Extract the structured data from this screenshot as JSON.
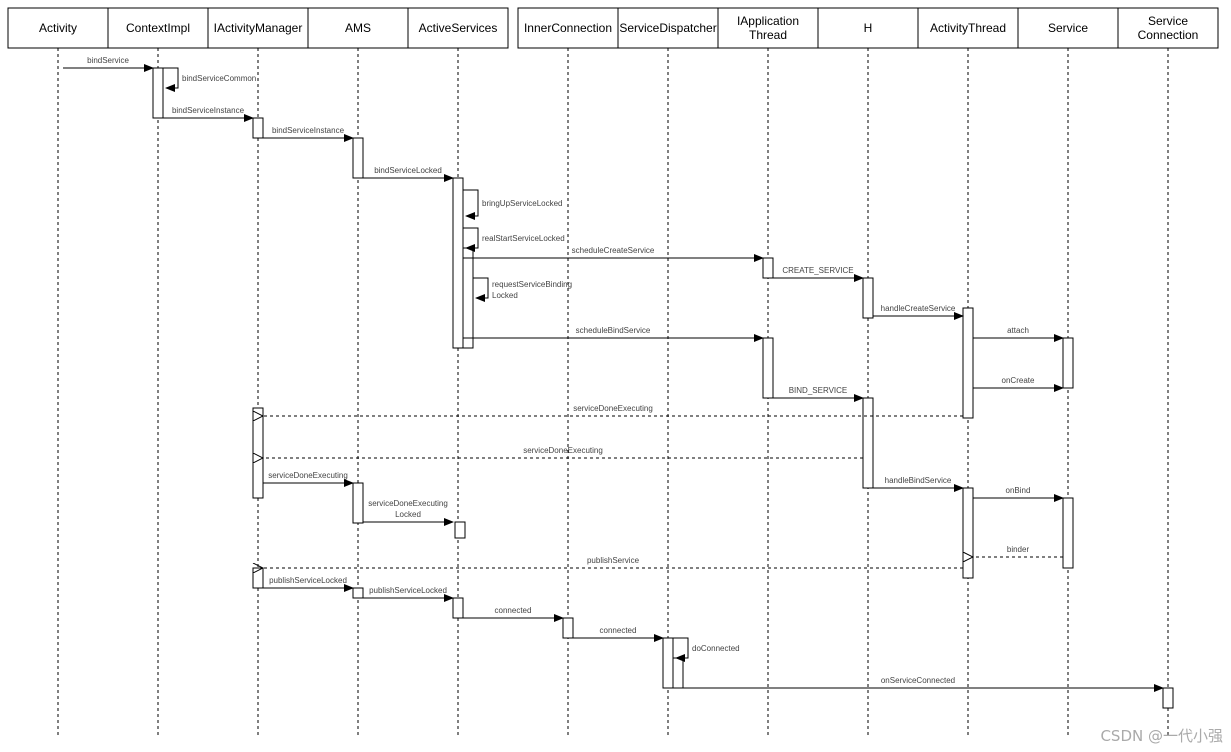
{
  "participants": [
    "Activity",
    "ContextImpl",
    "IActivityManager",
    "AMS",
    "ActiveServices",
    "InnerConnection",
    "ServiceDispatcher",
    "IApplication\nThread",
    "H",
    "ActivityThread",
    "Service",
    "Service\nConnection"
  ],
  "messages": [
    {
      "label": "bindService",
      "from": 0,
      "to": 1,
      "kind": "sync"
    },
    {
      "label": "bindServiceCommon",
      "from": 1,
      "to": 1,
      "kind": "self"
    },
    {
      "label": "bindServiceInstance",
      "from": 1,
      "to": 2,
      "kind": "sync"
    },
    {
      "label": "bindServiceInstance",
      "from": 2,
      "to": 3,
      "kind": "sync"
    },
    {
      "label": "bindServiceLocked",
      "from": 3,
      "to": 4,
      "kind": "sync"
    },
    {
      "label": "bringUpServiceLocked",
      "from": 4,
      "to": 4,
      "kind": "self"
    },
    {
      "label": "realStartServiceLocked",
      "from": 4,
      "to": 4,
      "kind": "self"
    },
    {
      "label": "scheduleCreateService",
      "from": 4,
      "to": 7,
      "kind": "sync"
    },
    {
      "label": "CREATE_SERVICE",
      "from": 7,
      "to": 8,
      "kind": "sync"
    },
    {
      "label": "requestServiceBinding\nLocked",
      "from": 4,
      "to": 4,
      "kind": "self"
    },
    {
      "label": "handleCreateService",
      "from": 8,
      "to": 9,
      "kind": "sync"
    },
    {
      "label": "scheduleBindService",
      "from": 4,
      "to": 7,
      "kind": "sync"
    },
    {
      "label": "attach",
      "from": 9,
      "to": 10,
      "kind": "sync"
    },
    {
      "label": "onCreate",
      "from": 9,
      "to": 10,
      "kind": "sync"
    },
    {
      "label": "BIND_SERVICE",
      "from": 7,
      "to": 8,
      "kind": "sync"
    },
    {
      "label": "serviceDoneExecuting",
      "from": 9,
      "to": 2,
      "kind": "return"
    },
    {
      "label": "serviceDoneExecuting",
      "from": 8,
      "to": 2,
      "kind": "return"
    },
    {
      "label": "serviceDoneExecuting",
      "from": 2,
      "to": 3,
      "kind": "sync"
    },
    {
      "label": "handleBindService",
      "from": 8,
      "to": 9,
      "kind": "sync"
    },
    {
      "label": "onBind",
      "from": 9,
      "to": 10,
      "kind": "sync"
    },
    {
      "label": "serviceDoneExecuting\nLocked",
      "from": 3,
      "to": 4,
      "kind": "sync"
    },
    {
      "label": "binder",
      "from": 10,
      "to": 9,
      "kind": "return"
    },
    {
      "label": "publishService",
      "from": 9,
      "to": 2,
      "kind": "return"
    },
    {
      "label": "publishServiceLocked",
      "from": 2,
      "to": 3,
      "kind": "sync"
    },
    {
      "label": "publishServiceLocked",
      "from": 3,
      "to": 4,
      "kind": "sync"
    },
    {
      "label": "connected",
      "from": 4,
      "to": 5,
      "kind": "sync"
    },
    {
      "label": "connected",
      "from": 5,
      "to": 6,
      "kind": "sync"
    },
    {
      "label": "doConnected",
      "from": 6,
      "to": 6,
      "kind": "self"
    },
    {
      "label": "onServiceConnected",
      "from": 6,
      "to": 11,
      "kind": "sync"
    }
  ],
  "watermark": "CSDN @一代小强"
}
